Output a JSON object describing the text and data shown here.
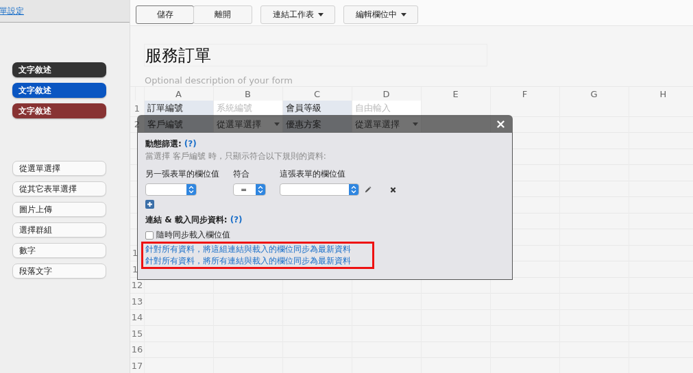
{
  "sidebar": {
    "settings_link": "單設定",
    "style_buttons": [
      {
        "label": "文字敘述",
        "color": "#333333"
      },
      {
        "label": "文字敘述",
        "color": "#0a56c2"
      },
      {
        "label": "文字敘述",
        "color": "#883333"
      }
    ],
    "field_buttons": [
      "從選單選擇",
      "從其它表單選擇",
      "圖片上傳",
      "選擇群組",
      "數字",
      "段落文字"
    ]
  },
  "toolbar": [
    {
      "label": "儲存",
      "kind": "default"
    },
    {
      "label": "離開",
      "kind": "plain"
    },
    {
      "label": "連結工作表",
      "kind": "dropdown"
    },
    {
      "label": "編輯欄位中",
      "kind": "dropdown"
    }
  ],
  "form": {
    "title": "服務訂單",
    "description_placeholder": "Optional description of your form"
  },
  "sheet": {
    "columns": [
      "A",
      "B",
      "C",
      "D",
      "E",
      "F",
      "G",
      "H"
    ],
    "rows": [
      {
        "number": "1",
        "cells": [
          {
            "text": "訂單編號",
            "kind": "label"
          },
          {
            "text": "系統編號",
            "kind": "hint"
          },
          {
            "text": "會員等級",
            "kind": "label"
          },
          {
            "text": "自由輸入",
            "kind": "hint"
          }
        ]
      },
      {
        "number": "2",
        "cells": [
          {
            "text": "客戶編號",
            "kind": "label"
          },
          {
            "text": "從選單選擇",
            "kind": "select"
          },
          {
            "text": "優惠方案",
            "kind": "label"
          },
          {
            "text": "從選單選擇",
            "kind": "select"
          }
        ]
      },
      {
        "covered": true
      },
      {
        "covered": true
      },
      {
        "covered": true
      },
      {
        "covered": true
      },
      {
        "covered": true
      },
      {
        "covered": true
      },
      {
        "covered": true
      },
      {
        "number": "1",
        "covered": true
      },
      {
        "number": "1",
        "covered": true
      },
      {
        "number": "12"
      },
      {
        "number": "13"
      },
      {
        "number": "14"
      },
      {
        "number": "15"
      },
      {
        "number": "16"
      },
      {
        "number": "17"
      }
    ]
  },
  "modal": {
    "filter_heading": "動態篩選:",
    "filter_help": "(?)",
    "filter_hint": "當選擇 客戶編號 時，只顯示符合以下規則的資料:",
    "rule_columns": [
      "另一張表單的欄位值",
      "符合",
      "這張表單的欄位值"
    ],
    "rule_selects": [
      {
        "kind": "field"
      },
      {
        "kind": "operator",
        "value": "="
      },
      {
        "kind": "wide"
      }
    ],
    "sync_heading": "連結 & 載入同步資料:",
    "sync_help": "(?)",
    "sync_checkbox": {
      "label": "隨時同步載入欄位值",
      "checked": false
    },
    "sync_links_highlighted": true,
    "sync_links": [
      "針對所有資料，將這組連結與載入的欄位同步為最新資料",
      "針對所有資料，將所有連結與載入的欄位同步為最新資料"
    ]
  }
}
